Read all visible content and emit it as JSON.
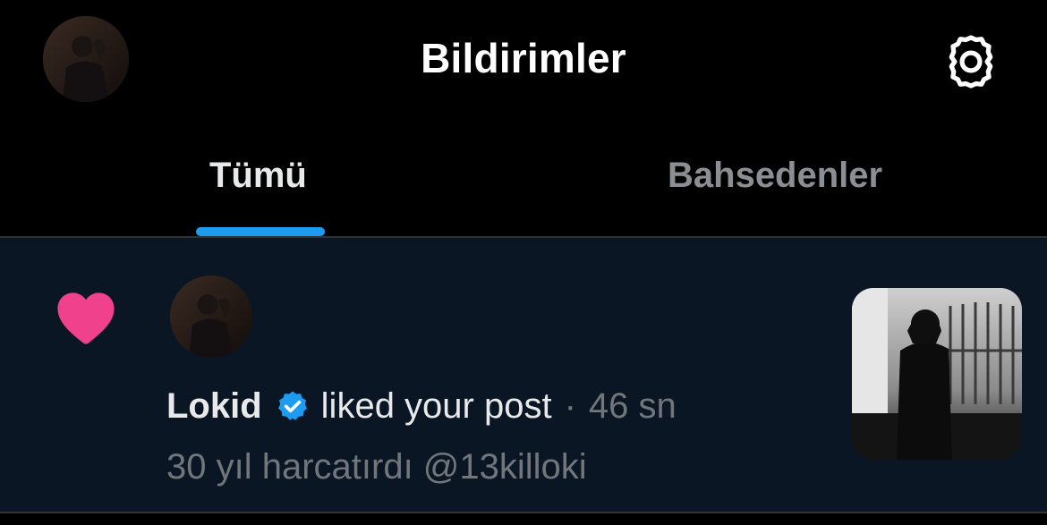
{
  "header": {
    "title": "Bildirimler",
    "avatar_icon": "profile-avatar",
    "settings_icon": "gear-icon"
  },
  "tabs": [
    {
      "label": "Tümü",
      "active": true
    },
    {
      "label": "Bahsedenler",
      "active": false
    }
  ],
  "notification": {
    "type_icon": "heart-icon",
    "avatar_icon": "user-avatar",
    "username": "Lokid",
    "verified": true,
    "action": "liked your post",
    "separator": "·",
    "time": "46 sn",
    "post_text": "30 yıl harcatırdı @13killoki",
    "thumbnail_icon": "post-thumbnail"
  },
  "colors": {
    "background": "#000000",
    "row_background": "#0a1624",
    "accent": "#1d9bf0",
    "heart": "#f0418d",
    "text_primary": "#e7e9ea",
    "text_secondary": "#71767b"
  }
}
